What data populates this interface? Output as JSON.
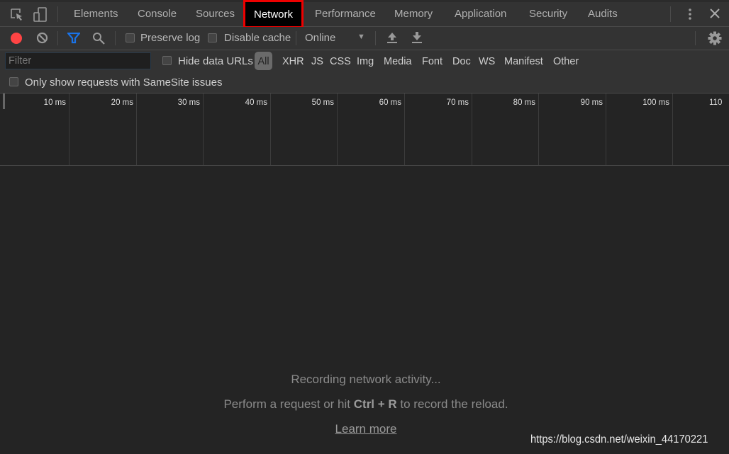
{
  "tabs": {
    "items": [
      "Elements",
      "Console",
      "Sources",
      "Network",
      "Performance",
      "Memory",
      "Application",
      "Security",
      "Audits"
    ],
    "active": "Network"
  },
  "toolbar": {
    "preserve_log": "Preserve log",
    "disable_cache": "Disable cache",
    "throttling": "Online",
    "record_color": "#f44",
    "filter_color": "#1a73e8"
  },
  "filterbar": {
    "filter_placeholder": "Filter",
    "hide_data_urls": "Hide data URLs",
    "types": [
      "All",
      "XHR",
      "JS",
      "CSS",
      "Img",
      "Media",
      "Font",
      "Doc",
      "WS",
      "Manifest",
      "Other"
    ],
    "active_type": "All",
    "samesite": "Only show requests with SameSite issues"
  },
  "timeline": {
    "ticks": [
      "10 ms",
      "20 ms",
      "30 ms",
      "40 ms",
      "50 ms",
      "60 ms",
      "70 ms",
      "80 ms",
      "90 ms",
      "100 ms",
      "110"
    ]
  },
  "empty": {
    "title": "Recording network activity...",
    "hint_pre": "Perform a request or hit ",
    "hint_key": "Ctrl + R",
    "hint_post": " to record the reload.",
    "learn_more": "Learn more"
  },
  "watermark": "https://blog.csdn.net/weixin_44170221"
}
